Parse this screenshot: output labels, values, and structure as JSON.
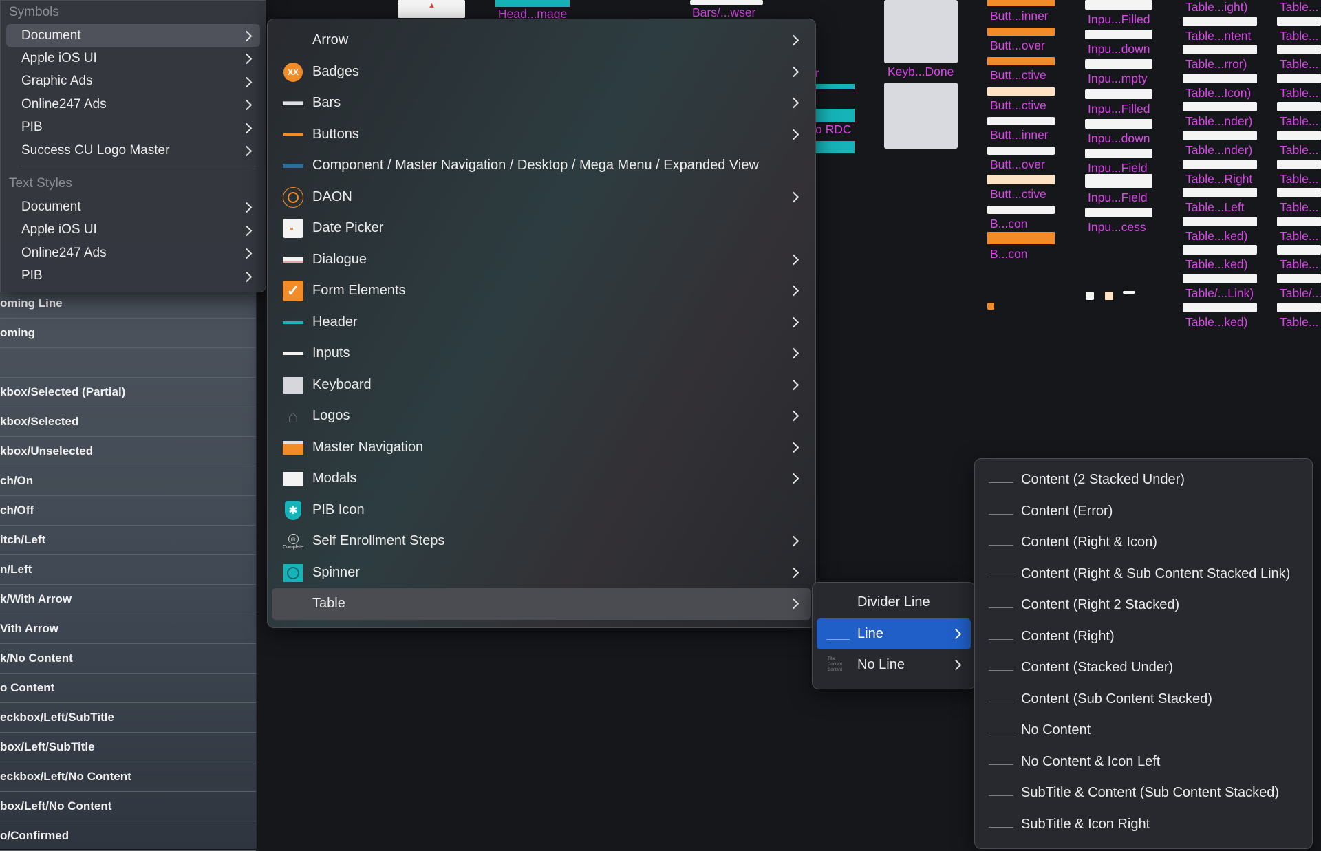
{
  "canvas": {
    "labels": {
      "head_image": "Head...mage",
      "bars_browser": "Bars/...wser",
      "keyboard_done": "Keyb...Done",
      "rdc": "o RDC",
      "r_partial": "r",
      "buttons": [
        "Butt...inner",
        "Butt...over",
        "Butt...ctive",
        "Butt...ctive",
        "Butt...inner",
        "Butt...over",
        "Butt...ctive",
        "B...con",
        "B...con"
      ],
      "inputs": [
        "Inpu...Filled",
        "Inpu...down",
        "Inpu...mpty",
        "Inpu...Filled",
        "Inpu...down",
        "Inpu...Field",
        "Inpu...Field",
        "Inpu...cess"
      ],
      "tables_a": [
        "Table...ight)",
        "Table...ntent",
        "Table...rror)",
        "Table...Icon)",
        "Table...nder)",
        "Table...nder)",
        "Table...Right",
        "Table...Left",
        "Table...ked)",
        "Table...ked)",
        "Table/...Link)",
        "Table...ked)"
      ],
      "tables_b": [
        "Table...",
        "Table...",
        "Table...",
        "Table...",
        "Table...",
        "Table...",
        "Table...",
        "Table...",
        "Table...",
        "Table...",
        "Table/...",
        "Table..."
      ]
    }
  },
  "sidebar": {
    "layers": [
      "oming Line",
      "oming",
      "",
      "kbox/Selected (Partial)",
      "kbox/Selected",
      "kbox/Unselected",
      "ch/On",
      "ch/Off",
      "itch/Left",
      "n/Left",
      "k/With Arrow",
      "Vith Arrow",
      "k/No Content",
      "o Content",
      "eckbox/Left/SubTitle",
      "box/Left/SubTitle",
      "eckbox/Left/No Content",
      "box/Left/No Content",
      "o/Confirmed"
    ]
  },
  "menu_symbols": {
    "header_symbols": "Symbols",
    "header_text_styles": "Text Styles",
    "symbols": [
      "Document",
      "Apple iOS UI",
      "Graphic Ads",
      "Online247 Ads",
      "PIB",
      "Success CU Logo Master"
    ],
    "text_styles": [
      "Document",
      "Apple iOS UI",
      "Online247 Ads",
      "PIB"
    ]
  },
  "menu_document": {
    "items": [
      {
        "label": "Arrow",
        "icon": "none",
        "has_submenu": true
      },
      {
        "label": "Badges",
        "icon": "badge-xx-icon",
        "badge_text": "XX",
        "has_submenu": true
      },
      {
        "label": "Bars",
        "icon": "bar-thumbnail-icon",
        "has_submenu": true
      },
      {
        "label": "Buttons",
        "icon": "button-thumbnail-icon",
        "has_submenu": true
      },
      {
        "label": "Component / Master Navigation / Desktop / Mega Menu / Expanded View",
        "icon": "mega-menu-thumbnail-icon",
        "has_submenu": false
      },
      {
        "label": "DAON",
        "icon": "daon-circle-icon",
        "has_submenu": true
      },
      {
        "label": "Date Picker",
        "icon": "date-picker-thumbnail-icon",
        "has_submenu": false
      },
      {
        "label": "Dialogue",
        "icon": "dialogue-thumbnail-icon",
        "has_submenu": true
      },
      {
        "label": "Form Elements",
        "icon": "checkbox-checked-icon",
        "has_submenu": true
      },
      {
        "label": "Header",
        "icon": "header-thumbnail-icon",
        "has_submenu": true
      },
      {
        "label": "Inputs",
        "icon": "input-thumbnail-icon",
        "has_submenu": true
      },
      {
        "label": "Keyboard",
        "icon": "keyboard-thumbnail-icon",
        "has_submenu": true
      },
      {
        "label": "Logos",
        "icon": "house-logo-icon",
        "has_submenu": true
      },
      {
        "label": "Master Navigation",
        "icon": "master-nav-thumbnail-icon",
        "has_submenu": true
      },
      {
        "label": "Modals",
        "icon": "modal-thumbnail-icon",
        "has_submenu": true
      },
      {
        "label": "PIB Icon",
        "icon": "shield-icon",
        "has_submenu": false
      },
      {
        "label": "Self Enrollment Steps",
        "icon": "step-complete-icon",
        "icon_caption": "Complete",
        "has_submenu": true
      },
      {
        "label": "Spinner",
        "icon": "spinner-thumbnail-icon",
        "has_submenu": true
      },
      {
        "label": "Table",
        "icon": "none",
        "has_submenu": true
      }
    ]
  },
  "menu_table": {
    "items": [
      {
        "label": "Divider Line",
        "has_submenu": false
      },
      {
        "label": "Line",
        "has_submenu": true
      },
      {
        "label": "No Line",
        "has_submenu": true,
        "thumb_lines": [
          "Title",
          "Content",
          "Content"
        ]
      }
    ]
  },
  "menu_line": {
    "items": [
      "Content (2 Stacked Under)",
      "Content (Error)",
      "Content (Right & Icon)",
      "Content (Right & Sub Content Stacked Link)",
      "Content (Right 2 Stacked)",
      "Content (Right)",
      "Content (Stacked Under)",
      "Content (Sub Content Stacked)",
      "No Content",
      "No Content & Icon Left",
      "SubTitle & Content (Sub Content Stacked)",
      "SubTitle & Icon Right"
    ]
  },
  "colors": {
    "accent_orange": "#f28c28",
    "accent_teal": "#16b3b8",
    "selection_blue": "#1f5fc7",
    "artboard_label": "#d946e8"
  }
}
